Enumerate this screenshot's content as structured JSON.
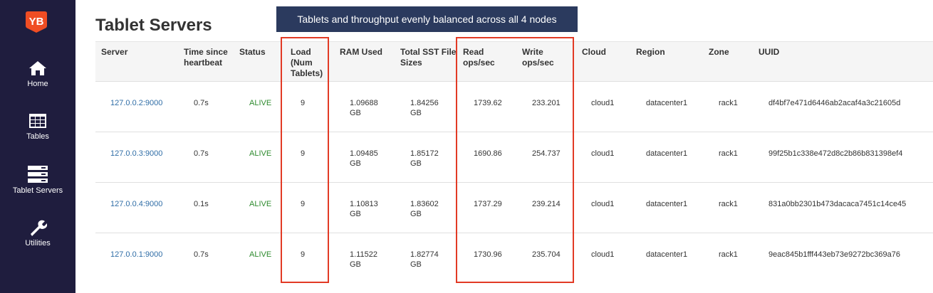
{
  "app": {
    "logo_text": "YB"
  },
  "sidebar": {
    "items": [
      {
        "label": "Home",
        "icon": "home-icon"
      },
      {
        "label": "Tables",
        "icon": "table-icon"
      },
      {
        "label": "Tablet Servers",
        "icon": "servers-icon"
      },
      {
        "label": "Utilities",
        "icon": "wrench-icon"
      }
    ]
  },
  "page": {
    "title": "Tablet Servers",
    "banner": "Tablets and throughput evenly balanced across all 4 nodes"
  },
  "table": {
    "headers": {
      "server": "Server",
      "heartbeat": "Time since heartbeat",
      "status": "Status",
      "load": "Load (Num Tablets)",
      "ram": "RAM Used",
      "sst": "Total SST File Sizes",
      "read": "Read ops/sec",
      "write": "Write ops/sec",
      "cloud": "Cloud",
      "region": "Region",
      "zone": "Zone",
      "uuid": "UUID"
    },
    "rows": [
      {
        "server": "127.0.0.2:9000",
        "heartbeat": "0.7s",
        "status": "ALIVE",
        "load": "9",
        "ram": "1.09688 GB",
        "sst": "1.84256 GB",
        "read": "1739.62",
        "write": "233.201",
        "cloud": "cloud1",
        "region": "datacenter1",
        "zone": "rack1",
        "uuid": "df4bf7e471d6446ab2acaf4a3c21605d"
      },
      {
        "server": "127.0.0.3:9000",
        "heartbeat": "0.7s",
        "status": "ALIVE",
        "load": "9",
        "ram": "1.09485 GB",
        "sst": "1.85172 GB",
        "read": "1690.86",
        "write": "254.737",
        "cloud": "cloud1",
        "region": "datacenter1",
        "zone": "rack1",
        "uuid": "99f25b1c338e472d8c2b86b831398ef4"
      },
      {
        "server": "127.0.0.4:9000",
        "heartbeat": "0.1s",
        "status": "ALIVE",
        "load": "9",
        "ram": "1.10813 GB",
        "sst": "1.83602 GB",
        "read": "1737.29",
        "write": "239.214",
        "cloud": "cloud1",
        "region": "datacenter1",
        "zone": "rack1",
        "uuid": "831a0bb2301b473dacaca7451c14ce45"
      },
      {
        "server": "127.0.0.1:9000",
        "heartbeat": "0.7s",
        "status": "ALIVE",
        "load": "9",
        "ram": "1.11522 GB",
        "sst": "1.82774 GB",
        "read": "1730.96",
        "write": "235.704",
        "cloud": "cloud1",
        "region": "datacenter1",
        "zone": "rack1",
        "uuid": "9eac845b1fff443eb73e9272bc369a76"
      }
    ]
  },
  "colors": {
    "sidebar": "#1f1d3e",
    "logo": "#f04d23",
    "banner": "#2b3a5e",
    "highlight": "#e23a25",
    "link": "#2f6da6",
    "alive": "#2e8b2e"
  }
}
